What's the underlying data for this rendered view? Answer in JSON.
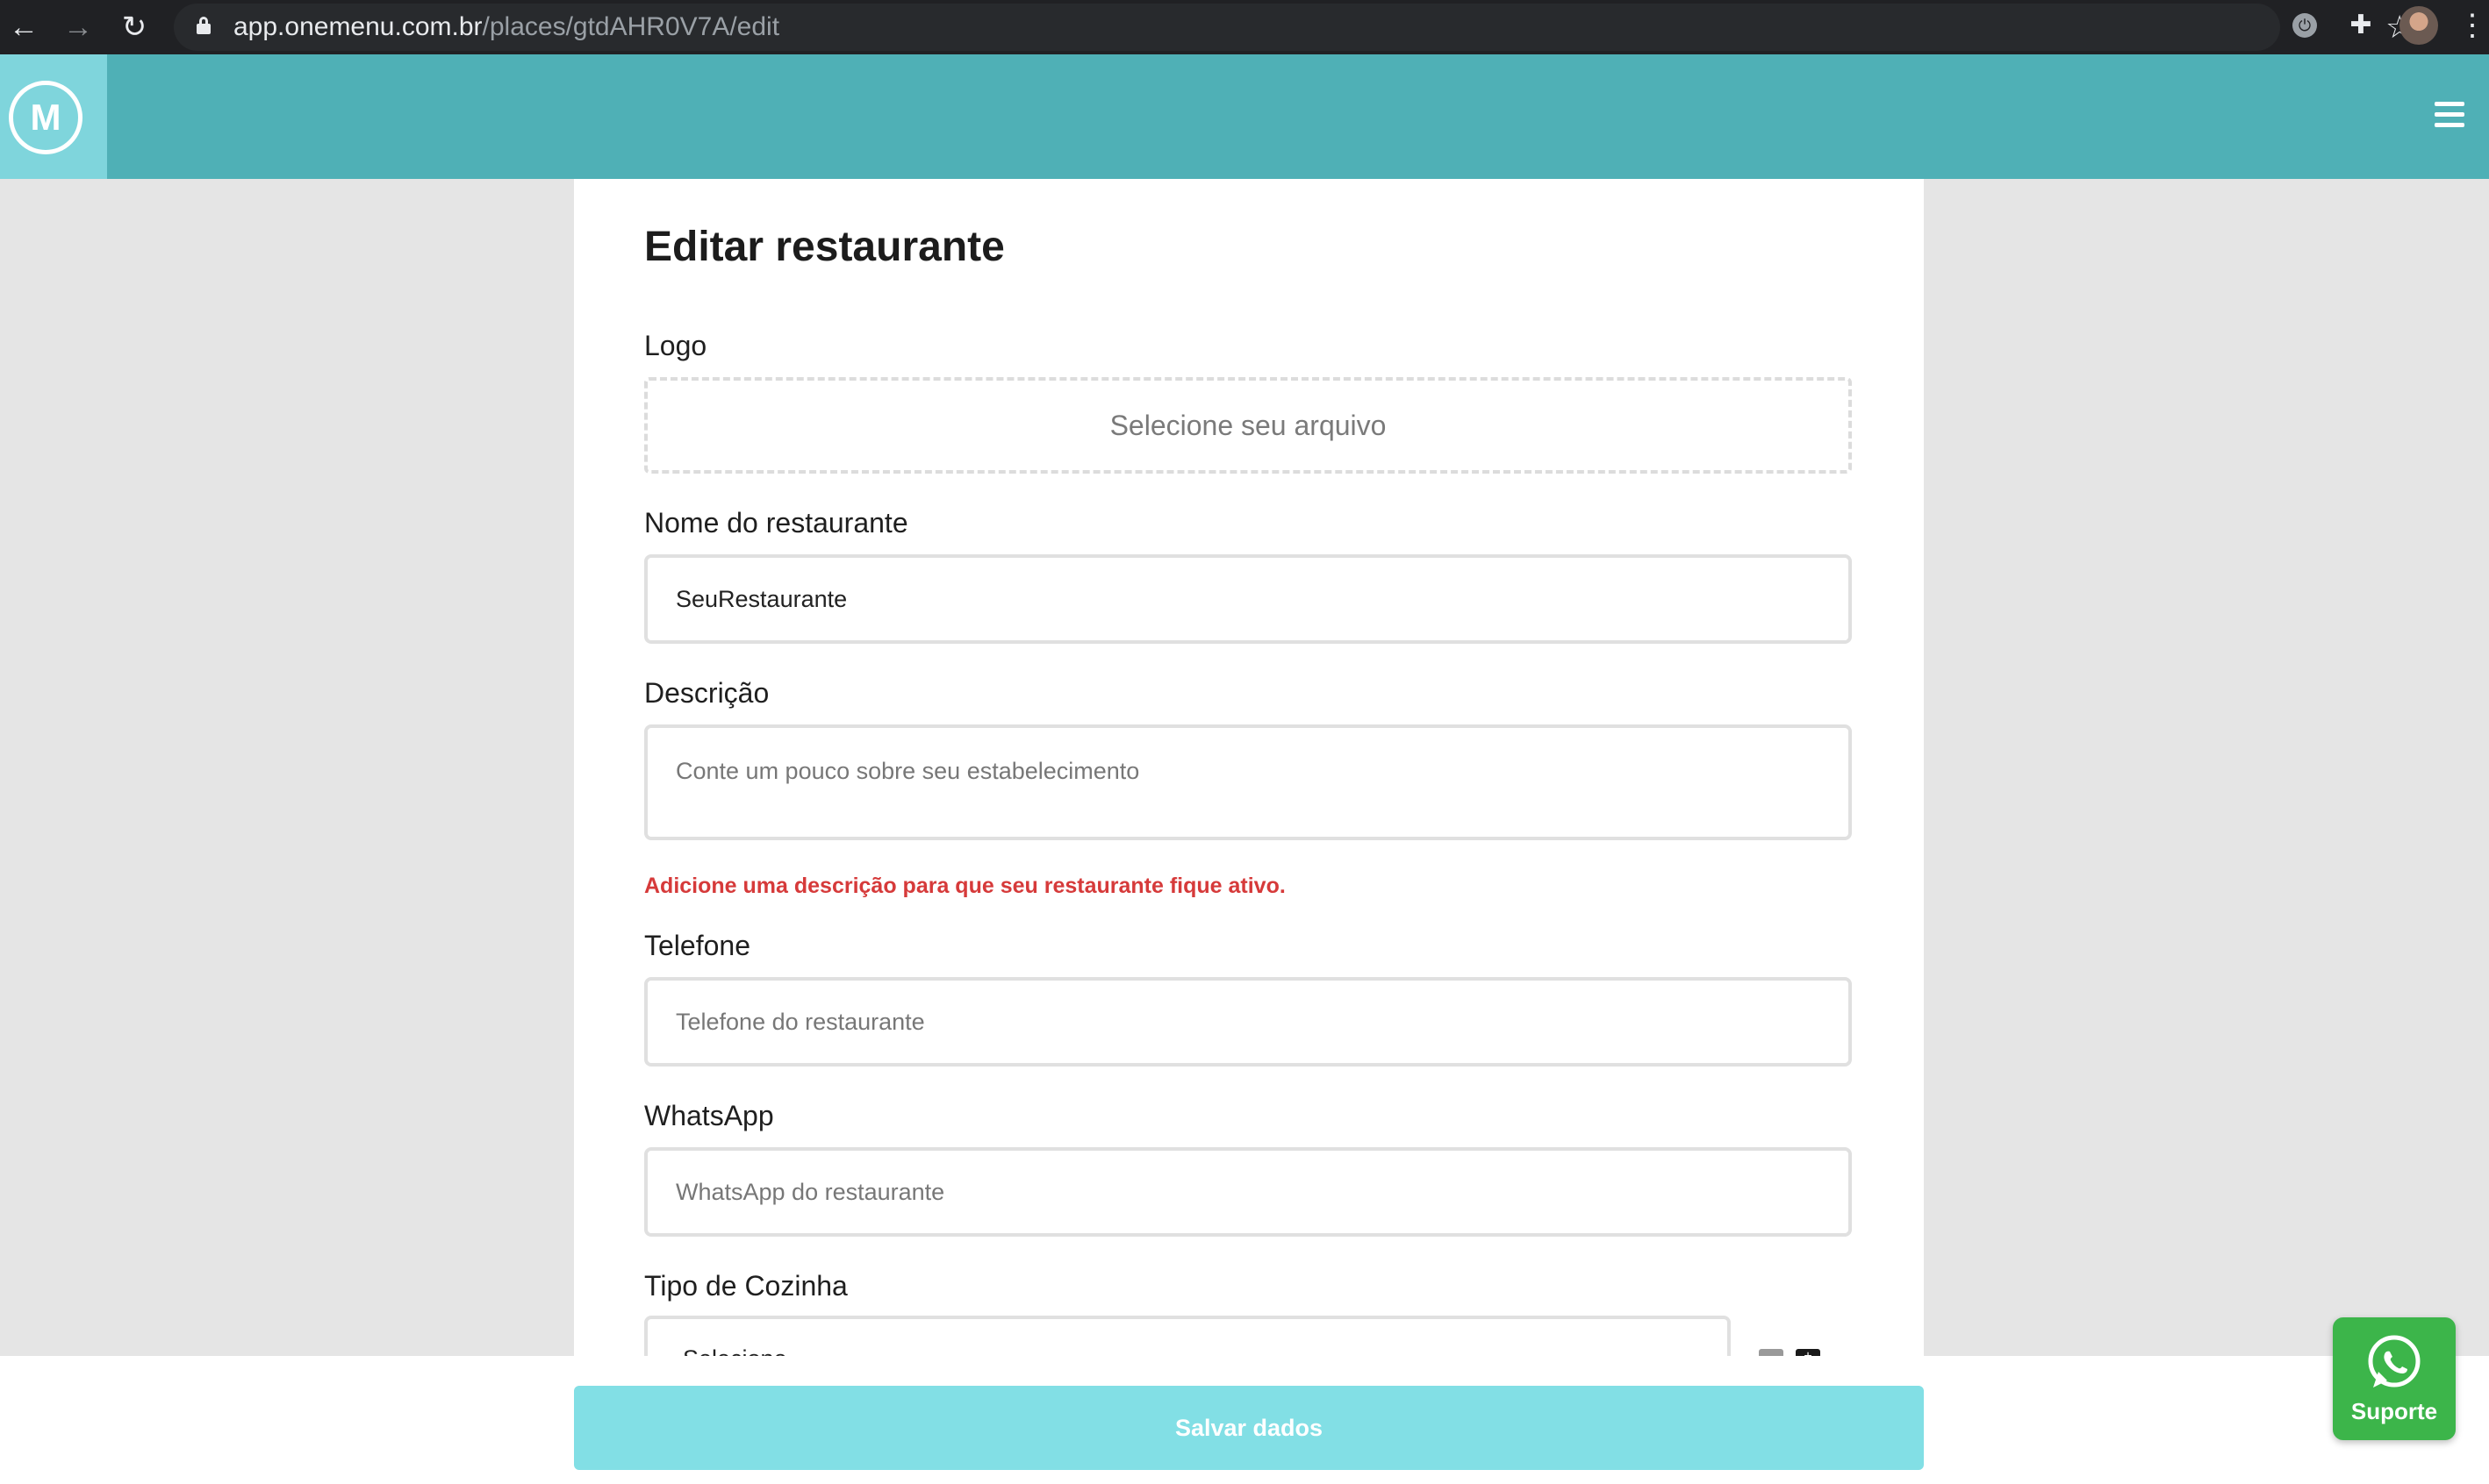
{
  "browser": {
    "url_host": "app.onemenu.com.br",
    "url_path": "/places/gtdAHR0V7A/edit"
  },
  "header": {
    "logo_letter": "M"
  },
  "form": {
    "title": "Editar restaurante",
    "logo": {
      "label": "Logo",
      "dropzone_text": "Selecione seu arquivo"
    },
    "name": {
      "label": "Nome do restaurante",
      "value": "SeuRestaurante"
    },
    "description": {
      "label": "Descrição",
      "placeholder": "Conte um pouco sobre seu estabelecimento",
      "error": "Adicione uma descrição para que seu restaurante fique ativo."
    },
    "phone": {
      "label": "Telefone",
      "placeholder": "Telefone do restaurante"
    },
    "whatsapp": {
      "label": "WhatsApp",
      "placeholder": "WhatsApp do restaurante"
    },
    "cuisine": {
      "label": "Tipo de Cozinha",
      "value": "Selecione"
    }
  },
  "footer": {
    "save_label": "Salvar dados"
  },
  "support": {
    "label": "Suporte"
  },
  "colors": {
    "header": "#4fb0b6",
    "brand": "#7fd5dc",
    "save_button": "#82dfe5",
    "error": "#d63a3a",
    "support": "#3cb54a"
  }
}
